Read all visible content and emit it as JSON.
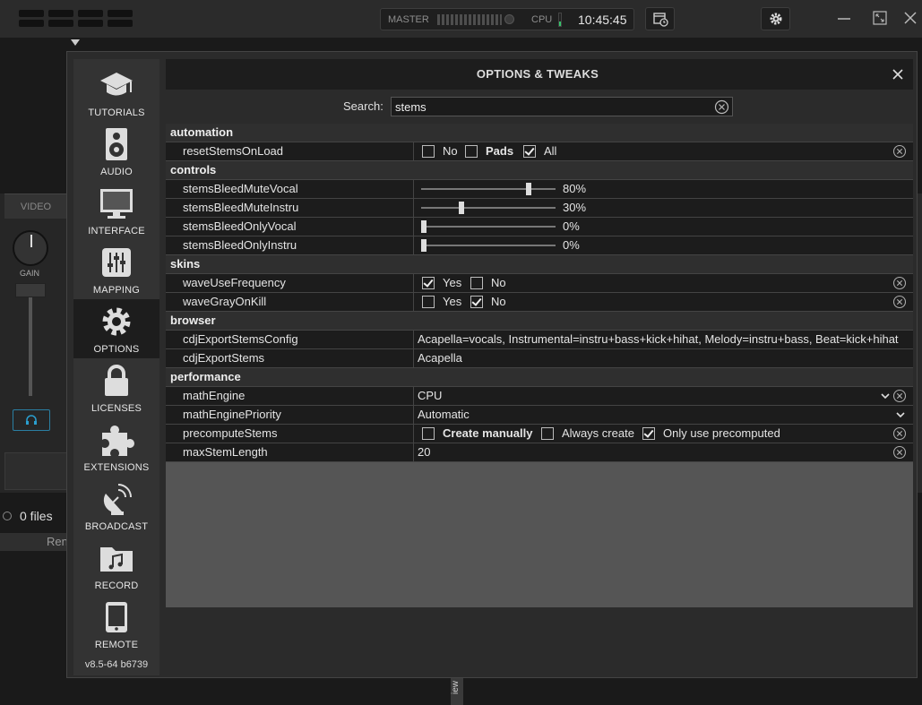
{
  "topbar": {
    "master_label": "MASTER",
    "cpu_label": "CPU",
    "clock": "10:45:45"
  },
  "background": {
    "video_tab": "VIDEO",
    "gain_label": "GAIN",
    "files_count": "0 files",
    "rem_text": "Ren",
    "bottom_tab": "iew"
  },
  "nav": {
    "items": [
      {
        "label": "TUTORIALS",
        "icon": "graduation-cap-icon"
      },
      {
        "label": "AUDIO",
        "icon": "speaker-icon"
      },
      {
        "label": "INTERFACE",
        "icon": "monitor-icon"
      },
      {
        "label": "MAPPING",
        "icon": "sliders-icon"
      },
      {
        "label": "OPTIONS",
        "icon": "gear-icon",
        "active": true
      },
      {
        "label": "LICENSES",
        "icon": "lock-icon"
      },
      {
        "label": "EXTENSIONS",
        "icon": "puzzle-icon"
      },
      {
        "label": "BROADCAST",
        "icon": "satellite-dish-icon"
      },
      {
        "label": "RECORD",
        "icon": "music-folder-icon"
      },
      {
        "label": "REMOTE",
        "icon": "tablet-icon"
      }
    ],
    "version": "v8.5-64 b6739"
  },
  "panel": {
    "title": "OPTIONS & TWEAKS",
    "search_label": "Search:",
    "search_value": "stems"
  },
  "options": {
    "categories": {
      "automation": "automation",
      "controls": "controls",
      "skins": "skins",
      "browser": "browser",
      "performance": "performance"
    },
    "resetStemsOnLoad": {
      "name": "resetStemsOnLoad",
      "choices": [
        {
          "label": "No",
          "checked": false,
          "bold": false
        },
        {
          "label": "Pads",
          "checked": false,
          "bold": true
        },
        {
          "label": "All",
          "checked": true,
          "bold": false
        }
      ]
    },
    "stemsBleedMuteVocal": {
      "name": "stemsBleedMuteVocal",
      "value": "80%",
      "fraction": 0.8
    },
    "stemsBleedMuteInstru": {
      "name": "stemsBleedMuteInstru",
      "value": "30%",
      "fraction": 0.3
    },
    "stemsBleedOnlyVocal": {
      "name": "stemsBleedOnlyVocal",
      "value": "0%",
      "fraction": 0
    },
    "stemsBleedOnlyInstru": {
      "name": "stemsBleedOnlyInstru",
      "value": "0%",
      "fraction": 0
    },
    "waveUseFrequency": {
      "name": "waveUseFrequency",
      "choices": [
        {
          "label": "Yes",
          "checked": true
        },
        {
          "label": "No",
          "checked": false
        }
      ]
    },
    "waveGrayOnKill": {
      "name": "waveGrayOnKill",
      "choices": [
        {
          "label": "Yes",
          "checked": false
        },
        {
          "label": "No",
          "checked": true
        }
      ]
    },
    "cdjExportStemsConfig": {
      "name": "cdjExportStemsConfig",
      "value": "Acapella=vocals, Instrumental=instru+bass+kick+hihat, Melody=instru+bass, Beat=kick+hihat"
    },
    "cdjExportStems": {
      "name": "cdjExportStems",
      "value": "Acapella"
    },
    "mathEngine": {
      "name": "mathEngine",
      "value": "CPU"
    },
    "mathEnginePriority": {
      "name": "mathEnginePriority",
      "value": "Automatic"
    },
    "precomputeStems": {
      "name": "precomputeStems",
      "choices": [
        {
          "label": "Create manually",
          "checked": false,
          "bold": true
        },
        {
          "label": "Always create",
          "checked": false,
          "bold": false
        },
        {
          "label": "Only use precomputed",
          "checked": true,
          "bold": false
        }
      ]
    },
    "maxStemLength": {
      "name": "maxStemLength",
      "value": "20"
    }
  },
  "colors": {
    "accent_headphones": "#2a7fa3",
    "cpu_meter": "#35c46a"
  }
}
